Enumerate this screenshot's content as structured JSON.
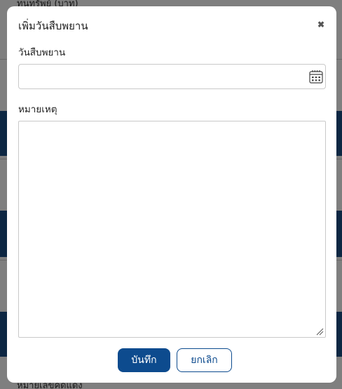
{
  "background": {
    "top_text": "ทุนทรัพย์ (บาท)",
    "bottom_text": "หมายเลขคดีแดง",
    "band_color": "#1a4f86"
  },
  "modal": {
    "title": "เพิ่มวันสืบพยาน",
    "close_icon": "close-icon",
    "date_field": {
      "label": "วันสืบพยาน",
      "value": "",
      "placeholder": "",
      "icon": "calendar-icon"
    },
    "note_field": {
      "label": "หมายเหตุ",
      "value": ""
    },
    "buttons": {
      "save_label": "บันทึก",
      "cancel_label": "ยกเลิก"
    },
    "colors": {
      "primary": "#0d4b8e"
    }
  }
}
